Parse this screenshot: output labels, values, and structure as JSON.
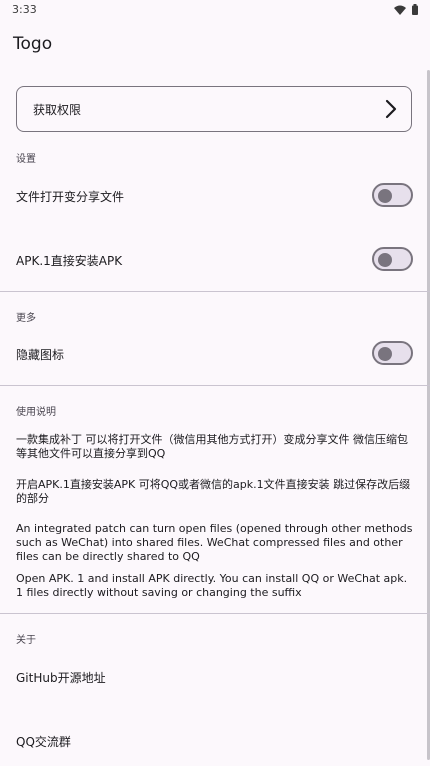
{
  "status_bar": {
    "time": "3:33",
    "icons": [
      "wifi-icon",
      "battery-icon"
    ]
  },
  "app": {
    "title": "Togo"
  },
  "permission": {
    "label": "获取权限",
    "icon": "chevron-right-icon"
  },
  "settings": {
    "title": "设置",
    "items": [
      {
        "label": "文件打开变分享文件",
        "enabled": false
      },
      {
        "label": "APK.1直接安装APK",
        "enabled": false
      }
    ]
  },
  "more": {
    "title": "更多",
    "items": [
      {
        "label": "隐藏图标",
        "enabled": false
      }
    ]
  },
  "usage": {
    "title": "使用说明",
    "paragraphs": [
      "一款集成补丁 可以将打开文件（微信用其他方式打开）变成分享文件 微信压缩包等其他文件可以直接分享到QQ",
      "开启APK.1直接安装APK 可将QQ或者微信的apk.1文件直接安装 跳过保存改后缀的部分",
      "An integrated patch can turn open files (opened through other methods such as WeChat) into shared files. WeChat compressed files and other files can be directly shared to QQ",
      " Open APK. 1 and install APK directly. You can install QQ or WeChat apk. 1 files directly without saving or changing the suffix"
    ]
  },
  "about": {
    "title": "关于",
    "links": [
      "GitHub开源地址",
      "QQ交流群"
    ]
  },
  "colors": {
    "background": "#fcf8fc",
    "outline": "#79747e",
    "switch_track": "#e7e0ec",
    "divider": "#cac4d0"
  }
}
